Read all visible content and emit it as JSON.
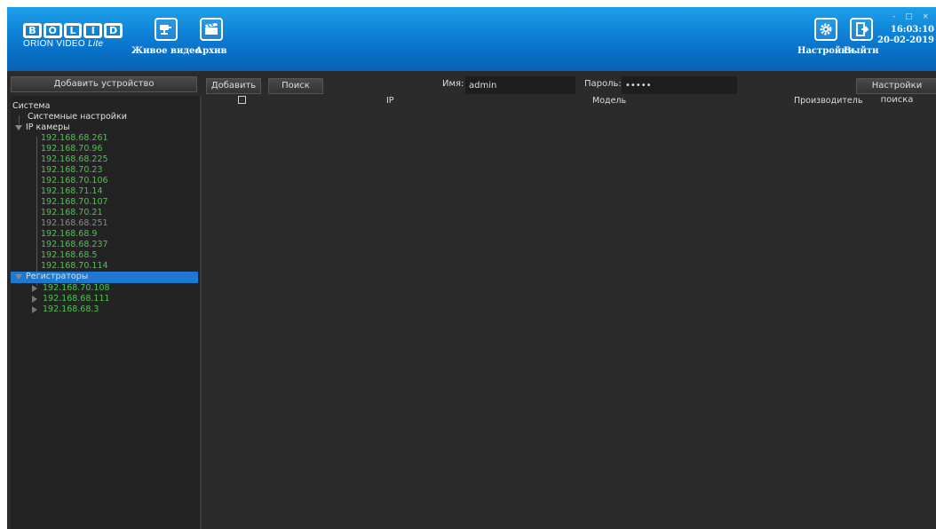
{
  "header": {
    "logo_word": "BOLID",
    "logo_letters": [
      "B",
      "O",
      "L",
      "I",
      "D"
    ],
    "logo_sub_main": "ORION VIDEO",
    "logo_sub_italic": "Lite",
    "nav": [
      {
        "label": "Живое видео",
        "icon": "camera-icon"
      },
      {
        "label": "Архив",
        "icon": "clapperboard-icon"
      }
    ],
    "settings_label": "Настройки",
    "exit_label": "Выйти",
    "time": "16:03:10",
    "date": "20-02-2019",
    "window_controls": "- □ ×"
  },
  "sidebar": {
    "add_device_label": "Добавить устройство",
    "root_label": "Система",
    "system_settings_label": "Системные настройки",
    "ip_cameras_label": "IP камеры",
    "cameras": [
      "192.168.68.261",
      "192.168.70.96",
      "192.168.68.225",
      "192.168.70.23",
      "192.168.70.106",
      "192.168.71.14",
      "192.168.70.107",
      "192.168.70.21",
      "192.168.68.251",
      "192.168.68.9",
      "192.168.68.237",
      "192.168.68.5",
      "192.168.70.114"
    ],
    "recorders_label": "Регистраторы",
    "recorders": [
      "192.168.70.108",
      "192.168.68.111",
      "192.168.68.3"
    ]
  },
  "toolbar": {
    "add_label": "Добавить",
    "search_label": "Поиск",
    "name_label": "Имя:",
    "name_value": "admin",
    "password_label": "Пароль:",
    "password_value": "•••••",
    "search_settings_label": "Настройки поиска"
  },
  "table": {
    "columns": [
      "IP",
      "Модель",
      "Производитель"
    ]
  }
}
